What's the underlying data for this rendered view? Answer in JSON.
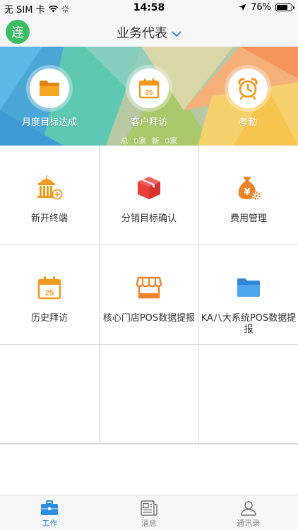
{
  "status_bar": {
    "carrier": "无 SIM 卡",
    "time": "14:58",
    "battery_percent": "76%",
    "battery_level": 0.76
  },
  "nav": {
    "avatar_text": "连",
    "title": "业务代表",
    "avatar_color": "#3dbd63"
  },
  "banner": {
    "items": [
      {
        "label": "月度目标达成",
        "icon": "folder-icon"
      },
      {
        "label": "客户拜访",
        "icon": "calendar-icon"
      },
      {
        "label": "考勤",
        "icon": "alarm-clock-icon"
      }
    ],
    "stats": {
      "total_label": "总",
      "total_value": "0家",
      "new_label": "新",
      "new_value": "0家"
    }
  },
  "grid": {
    "cells": [
      {
        "label": "新开终端",
        "icon": "building-add-icon"
      },
      {
        "label": "分销目标确认",
        "icon": "box-icon"
      },
      {
        "label": "费用管理",
        "icon": "money-bag-icon"
      },
      {
        "label": "历史拜访",
        "icon": "calendar-icon"
      },
      {
        "label": "核心门店POS数据提报",
        "icon": "store-icon"
      },
      {
        "label": "KA八大系统POS数据提报",
        "icon": "folder-icon"
      }
    ],
    "calendar_day": "25"
  },
  "tabs": [
    {
      "label": "工作",
      "icon": "briefcase-icon",
      "active": true
    },
    {
      "label": "消息",
      "icon": "newspaper-icon",
      "active": false
    },
    {
      "label": "通讯录",
      "icon": "contact-icon",
      "active": false
    }
  ],
  "colors": {
    "accent": "#2a8ee0",
    "orange": "#f29a1f",
    "red": "#e8413c",
    "blue": "#3a97e0"
  }
}
